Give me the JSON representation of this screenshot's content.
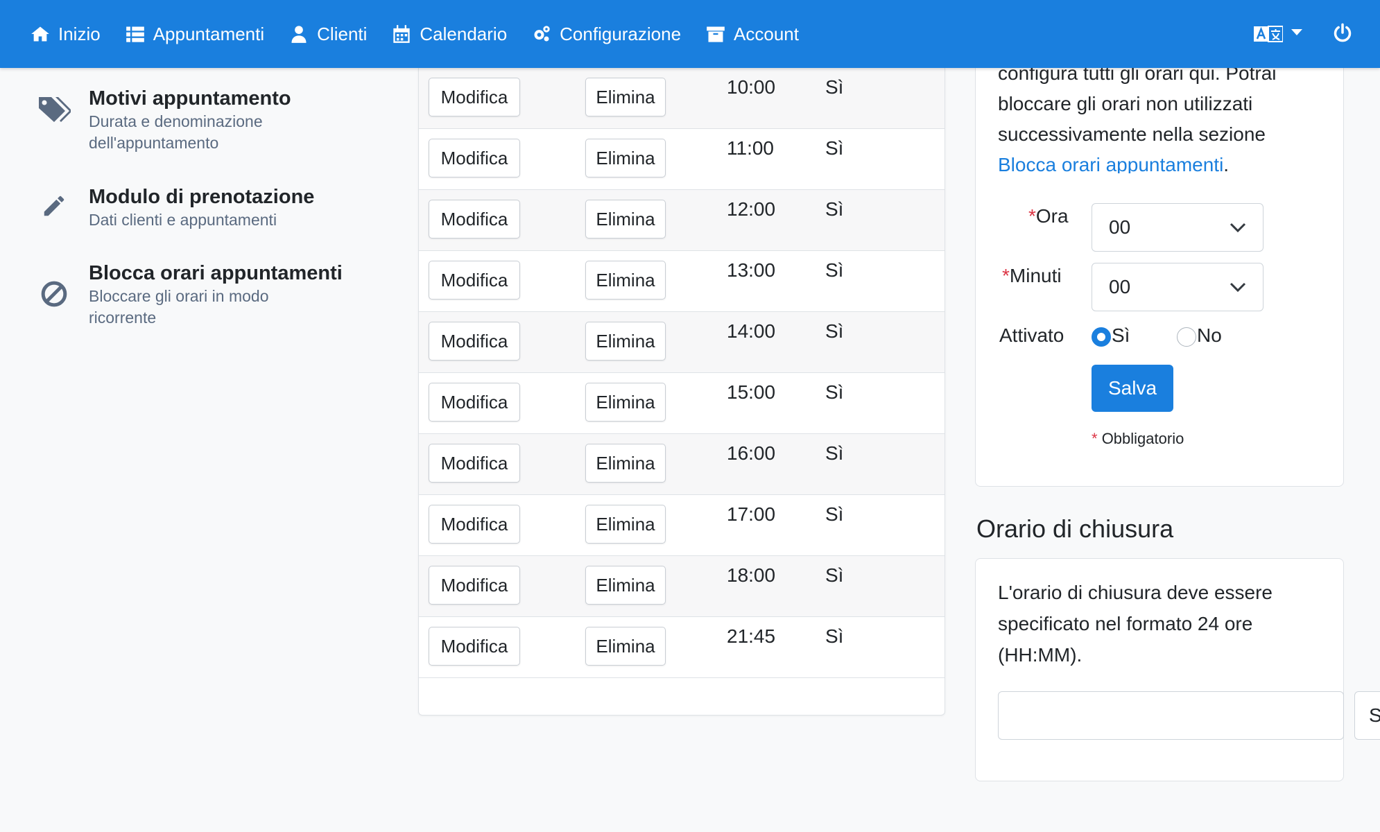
{
  "nav": {
    "items": [
      {
        "label": "Inizio",
        "icon": "home-icon"
      },
      {
        "label": "Appuntamenti",
        "icon": "list-icon"
      },
      {
        "label": "Clienti",
        "icon": "user-icon"
      },
      {
        "label": "Calendario",
        "icon": "calendar-icon"
      },
      {
        "label": "Configurazione",
        "icon": "gears-icon"
      },
      {
        "label": "Account",
        "icon": "archive-icon"
      }
    ],
    "language_icon": "language-icon",
    "power_icon": "power-icon",
    "color": "#1a7fde"
  },
  "sidebar": {
    "items": [
      {
        "title": "Motivi appuntamento",
        "desc": "Durata e denominazione dell'appuntamento",
        "icon": "tags-icon"
      },
      {
        "title": "Modulo di prenotazione",
        "desc": "Dati clienti e appuntamenti",
        "icon": "pencil-icon"
      },
      {
        "title": "Blocca orari appuntamenti",
        "desc": "Bloccare gli orari in modo ricorrente",
        "icon": "ban-icon"
      }
    ]
  },
  "table": {
    "edit_label": "Modifica",
    "delete_label": "Elimina",
    "rows": [
      {
        "time": "10:00",
        "active": "Sì"
      },
      {
        "time": "11:00",
        "active": "Sì"
      },
      {
        "time": "12:00",
        "active": "Sì"
      },
      {
        "time": "13:00",
        "active": "Sì"
      },
      {
        "time": "14:00",
        "active": "Sì"
      },
      {
        "time": "15:00",
        "active": "Sì"
      },
      {
        "time": "16:00",
        "active": "Sì"
      },
      {
        "time": "17:00",
        "active": "Sì"
      },
      {
        "time": "18:00",
        "active": "Sì"
      },
      {
        "time": "21:45",
        "active": "Sì"
      }
    ]
  },
  "form": {
    "intro_text": "configura tutti gli orari qui. Potrai bloccare gli orari non utilizzati successivamente nella sezione",
    "intro_link": "Blocca orari appuntamenti",
    "intro_end": ".",
    "required_mark": "*",
    "hour_label": "Ora",
    "hour_value": "00",
    "minutes_label": "Minuti",
    "minutes_value": "00",
    "enabled_label": "Attivato",
    "yes_label": "Sì",
    "no_label": "No",
    "enabled_selected": "Sì",
    "save_label": "Salva",
    "required_note": "Obbligatorio"
  },
  "closing": {
    "title": "Orario di chiusura",
    "text": "L'orario di chiusura deve essere specificato nel formato 24 ore (HH:MM).",
    "input_value": "",
    "button_label": "S"
  }
}
